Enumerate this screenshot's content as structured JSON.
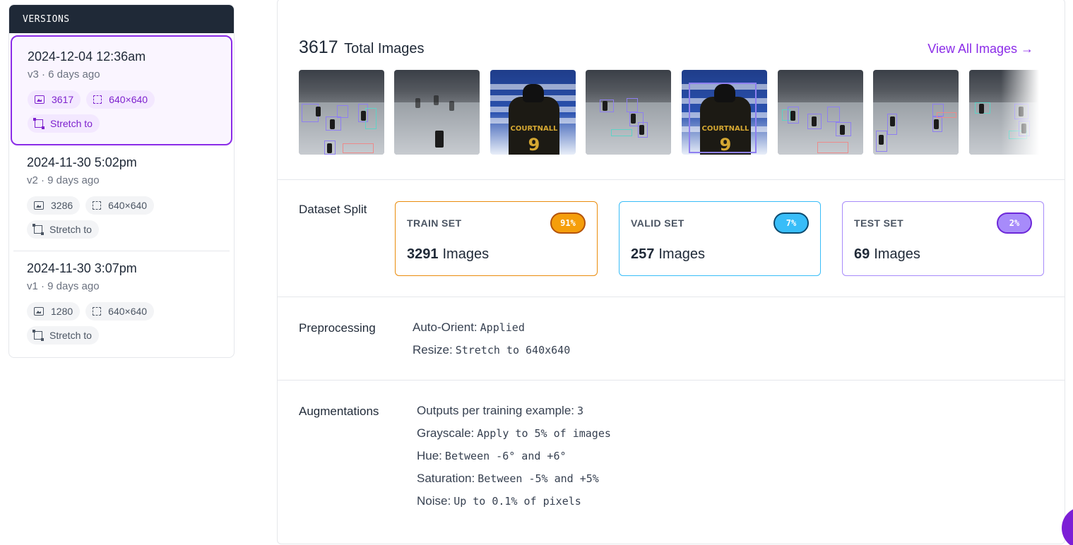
{
  "sidebar": {
    "header": "VERSIONS",
    "versions": [
      {
        "date": "2024-12-04 12:36am",
        "meta": "v3 · 6 days ago",
        "images": "3617",
        "size": "640×640",
        "resize": "Stretch to",
        "active": true
      },
      {
        "date": "2024-11-30 5:02pm",
        "meta": "v2 · 9 days ago",
        "images": "3286",
        "size": "640×640",
        "resize": "Stretch to",
        "active": false
      },
      {
        "date": "2024-11-30 3:07pm",
        "meta": "v1 · 9 days ago",
        "images": "1280",
        "size": "640×640",
        "resize": "Stretch to",
        "active": false
      }
    ]
  },
  "images": {
    "total_count": "3617",
    "total_label": "Total Images",
    "view_all": "View All Images →",
    "thumbnails": [
      {
        "name": "thumbnail-1",
        "kind": "rink"
      },
      {
        "name": "thumbnail-2",
        "kind": "rink"
      },
      {
        "name": "thumbnail-3",
        "kind": "jersey",
        "jersey_name": "COURTNALL",
        "jersey_number": "9"
      },
      {
        "name": "thumbnail-4",
        "kind": "rink"
      },
      {
        "name": "thumbnail-5",
        "kind": "jersey",
        "jersey_name": "COURTNALL",
        "jersey_number": "9"
      },
      {
        "name": "thumbnail-6",
        "kind": "rink"
      },
      {
        "name": "thumbnail-7",
        "kind": "rink"
      },
      {
        "name": "thumbnail-8",
        "kind": "rink"
      }
    ]
  },
  "split": {
    "label": "Dataset Split",
    "sets": [
      {
        "title": "TRAIN SET",
        "count": "3291",
        "unit": "Images",
        "percent": "91%",
        "color": "#ea8c0c",
        "badge_bg": "#f59e0b",
        "badge_border": "#b45309",
        "badge_text": "#ffffff"
      },
      {
        "title": "VALID SET",
        "count": "257",
        "unit": "Images",
        "percent": "7%",
        "color": "#38bdf8",
        "badge_bg": "#38bdf8",
        "badge_border": "#0c4a6e",
        "badge_text": "#ffffff"
      },
      {
        "title": "TEST SET",
        "count": "69",
        "unit": "Images",
        "percent": "2%",
        "color": "#a78bfa",
        "badge_bg": "#a78bfa",
        "badge_border": "#6d28d9",
        "badge_text": "#ffffff"
      }
    ]
  },
  "preprocessing": {
    "label": "Preprocessing",
    "items": [
      {
        "key": "Auto-Orient:",
        "value": "Applied"
      },
      {
        "key": "Resize:",
        "value": "Stretch to 640x640"
      }
    ]
  },
  "augmentations": {
    "label": "Augmentations",
    "items": [
      {
        "key": "Outputs per training example:",
        "value": "3"
      },
      {
        "key": "Grayscale:",
        "value": "Apply to 5% of images"
      },
      {
        "key": "Hue:",
        "value": "Between -6° and +6°"
      },
      {
        "key": "Saturation:",
        "value": "Between -5% and +5%"
      },
      {
        "key": "Noise:",
        "value": "Up to 0.1% of pixels"
      }
    ]
  },
  "colors": {
    "accent": "#8b2ce8",
    "sidebar_header_bg": "#1f2937"
  }
}
